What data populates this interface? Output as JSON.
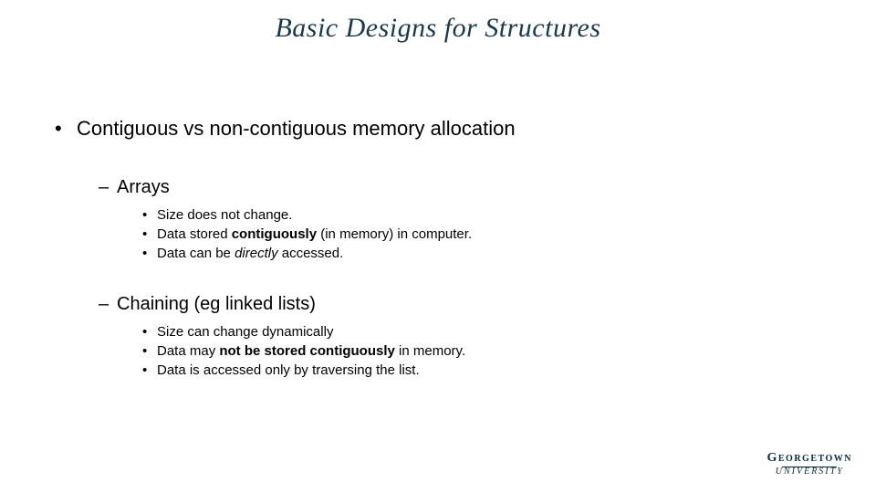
{
  "title": "Basic Designs for Structures",
  "bullets": {
    "main": "Contiguous vs non-contiguous memory allocation",
    "arrays": {
      "label": "Arrays",
      "p1_a": "Size does not change.",
      "p2_a": "Data stored ",
      "p2_b": "contiguously",
      "p2_c": " (in memory) in computer.",
      "p3_a": "Data can be ",
      "p3_b": "directly",
      "p3_c": " accessed."
    },
    "chaining": {
      "label": "Chaining (eg linked lists)",
      "p1_a": "Size can change dynamically",
      "p2_a": "Data may ",
      "p2_b": "not be stored contiguously",
      "p2_c": " in memory.",
      "p3_a": "Data is accessed only by traversing the list."
    }
  },
  "logo": {
    "line1": "Georgetown",
    "line2": "UNIVERSITY"
  }
}
